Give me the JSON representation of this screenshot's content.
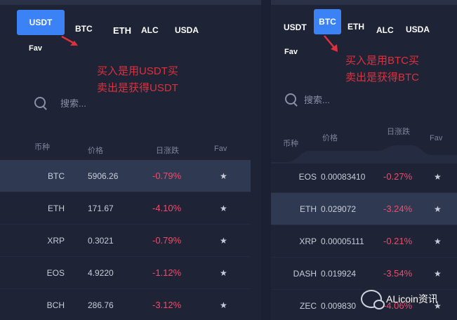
{
  "left": {
    "tabs": [
      {
        "label": "USDT",
        "active": true
      },
      {
        "label": "BTC",
        "active": false
      },
      {
        "label": "ETH",
        "active": false
      },
      {
        "label": "ALC",
        "active": false
      },
      {
        "label": "USDA",
        "active": false
      },
      {
        "label": "Fav",
        "active": false
      }
    ],
    "annotation": [
      "买入是用USDT买",
      "卖出是获得USDT"
    ],
    "search_placeholder": "搜索...",
    "headers": {
      "coin": "币种",
      "price": "价格",
      "change": "日涨跌",
      "fav": "Fav"
    },
    "rows": [
      {
        "symbol": "BTC",
        "price": "5906.26",
        "change": "-0.79%",
        "fav": "★",
        "highlighted": true
      },
      {
        "symbol": "ETH",
        "price": "171.67",
        "change": "-4.10%",
        "fav": "★",
        "highlighted": false
      },
      {
        "symbol": "XRP",
        "price": "0.3021",
        "change": "-0.79%",
        "fav": "★",
        "highlighted": false
      },
      {
        "symbol": "EOS",
        "price": "4.9220",
        "change": "-1.12%",
        "fav": "★",
        "highlighted": false
      },
      {
        "symbol": "BCH",
        "price": "286.76",
        "change": "-3.12%",
        "fav": "★",
        "highlighted": false
      }
    ]
  },
  "right": {
    "tabs": [
      {
        "label": "USDT",
        "active": false
      },
      {
        "label": "BTC",
        "active": true
      },
      {
        "label": "ETH",
        "active": false
      },
      {
        "label": "ALC",
        "active": false
      },
      {
        "label": "USDA",
        "active": false
      },
      {
        "label": "Fav",
        "active": false
      }
    ],
    "annotation": [
      "买入是用BTC买",
      "卖出是获得BTC"
    ],
    "search_placeholder": "搜索...",
    "headers": {
      "coin": "币种",
      "price": "价格",
      "change": "日涨跌",
      "fav": "Fav"
    },
    "rows": [
      {
        "symbol": "EOS",
        "price": "0.00083410",
        "change": "-0.27%",
        "fav": "★",
        "highlighted": false
      },
      {
        "symbol": "ETH",
        "price": "0.029072",
        "change": "-3.24%",
        "fav": "★",
        "highlighted": true
      },
      {
        "symbol": "XRP",
        "price": "0.00005111",
        "change": "-0.21%",
        "fav": "★",
        "highlighted": false
      },
      {
        "symbol": "DASH",
        "price": "0.019924",
        "change": "-3.54%",
        "fav": "★",
        "highlighted": false
      },
      {
        "symbol": "ZEC",
        "price": "0.009830",
        "change": "-4.06%",
        "fav": "★",
        "highlighted": false
      }
    ]
  },
  "watermark": {
    "text": "ALicoin资讯",
    "icon": "wechat-icon"
  },
  "colors": {
    "background": "#1e2336",
    "active_tab": "#3b82f6",
    "highlight_row": "#2f3a52",
    "negative_change": "#ef4c6a",
    "annotation": "#e0303c"
  }
}
